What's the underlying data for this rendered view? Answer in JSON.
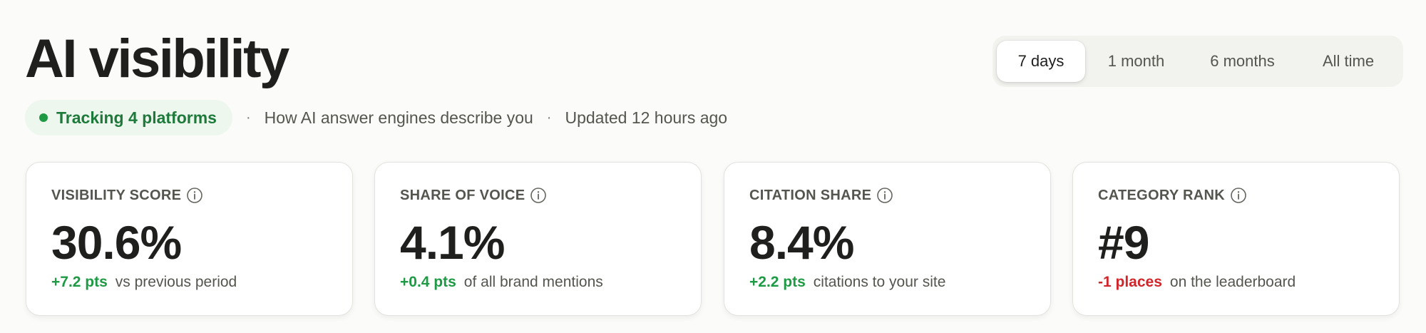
{
  "header": {
    "title": "AI visibility"
  },
  "range": {
    "options": [
      "7 days",
      "1 month",
      "6 months",
      "All time"
    ],
    "selected": "7 days"
  },
  "subtitle": {
    "status": "Tracking 4 platforms",
    "separator": "·",
    "description": "How AI answer engines describe you",
    "updated": "Updated 12 hours ago"
  },
  "colors": {
    "positive": "#1e9a45",
    "negative": "#d0262b",
    "status_dot": "#1e9a45"
  },
  "cards": [
    {
      "label": "VISIBILITY SCORE",
      "value": "30.6%",
      "delta": "+7.2 pts",
      "direction": "pos",
      "note": "vs previous period",
      "icon": "info-icon"
    },
    {
      "label": "SHARE OF VOICE",
      "value": "4.1%",
      "delta": "+0.4 pts",
      "direction": "pos",
      "note": "of all brand mentions",
      "icon": "info-icon"
    },
    {
      "label": "CITATION SHARE",
      "value": "8.4%",
      "delta": "+2.2 pts",
      "direction": "pos",
      "note": "citations to your site",
      "icon": "info-icon"
    },
    {
      "label": "CATEGORY RANK",
      "value": "#9",
      "delta": "-1 places",
      "direction": "neg",
      "note": "on the leaderboard",
      "icon": "info-icon"
    }
  ]
}
